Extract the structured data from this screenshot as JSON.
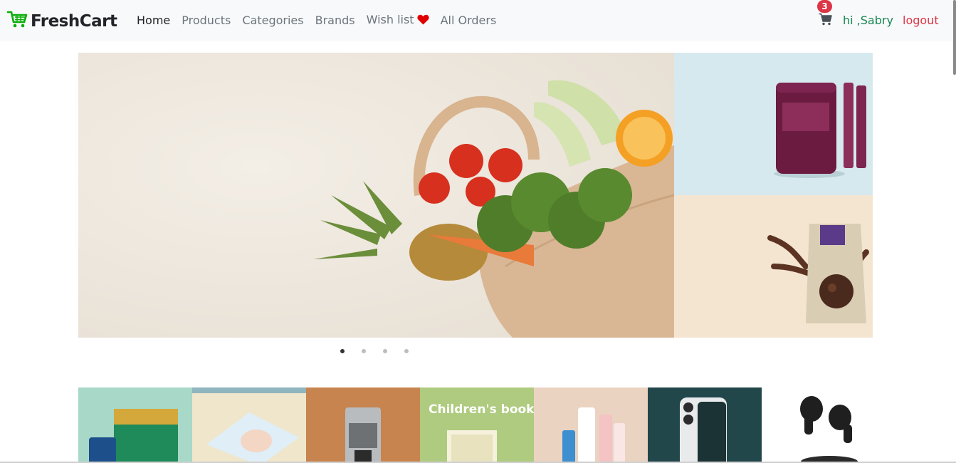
{
  "brand": {
    "name": "FreshCart"
  },
  "nav": {
    "links": [
      "Home",
      "Products",
      "Categories",
      "Brands",
      "Wish list",
      "All Orders"
    ]
  },
  "cart": {
    "count": "3"
  },
  "user": {
    "greeting": "hi ,Sabry",
    "logout_label": "logout"
  },
  "slider": {
    "slides": 4,
    "active": 1
  },
  "categories": {
    "children_books_title": "Children's books"
  },
  "colors": {
    "brand_green": "#0aad0a",
    "logout_red": "#dc3545",
    "greeting_green": "#198754"
  }
}
